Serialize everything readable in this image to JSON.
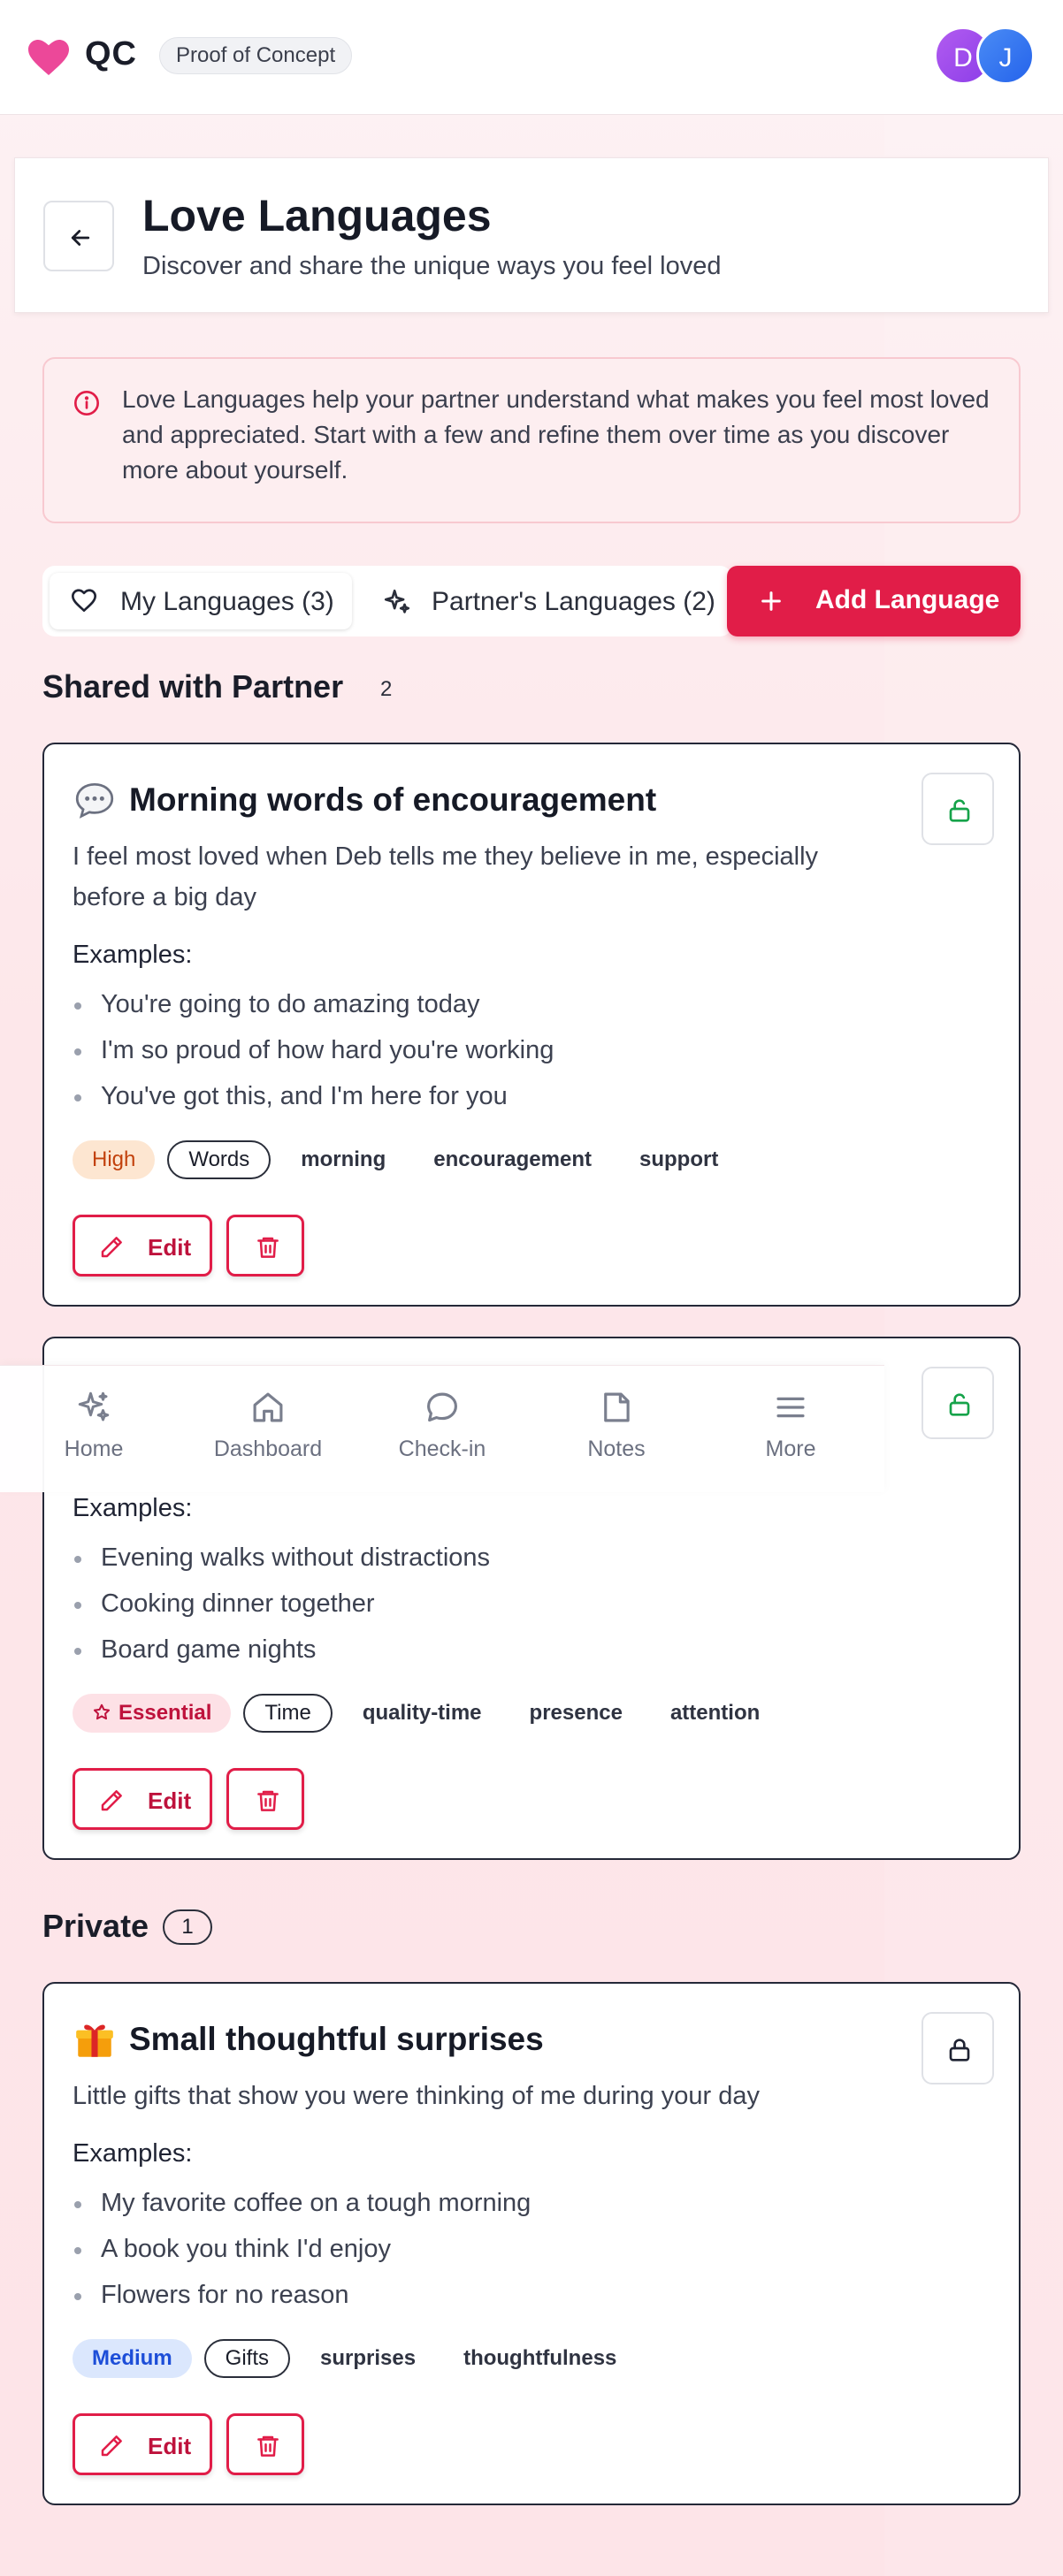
{
  "app": {
    "name": "QC",
    "badge": "Proof of Concept",
    "logo_icon": "heart-icon",
    "brand_color": "#e11d48",
    "avatars": [
      {
        "initial": "D",
        "color": "#a34bee"
      },
      {
        "initial": "J",
        "color": "#3577f0"
      }
    ]
  },
  "header": {
    "title": "Love Languages",
    "subtitle": "Discover and share the unique ways you feel loved"
  },
  "info": {
    "text": "Love Languages help your partner understand what makes you feel most loved and appreciated. Start with a few and refine them over time as you discover more about yourself."
  },
  "tabs": [
    {
      "label": "My Languages (3)",
      "icon": "heart-icon",
      "active": true
    },
    {
      "label": "Partner's Languages (2)",
      "icon": "sparkles-icon",
      "active": false
    }
  ],
  "add_button": {
    "label": "Add Language"
  },
  "sections": {
    "shared": {
      "title": "Shared with Partner",
      "count": "2"
    },
    "private": {
      "title": "Private",
      "count": "1"
    }
  },
  "examples_label": "Examples:",
  "edit_label": "Edit",
  "cards": [
    {
      "emoji": "speech-bubble",
      "title": "Morning words of encouragement",
      "description": "I feel most loved when Deb tells me they believe in me, especially before a big day",
      "examples": [
        "You're going to do amazing today",
        "I'm so proud of how hard you're working",
        "You've got this, and I'm here for you"
      ],
      "importance": "High",
      "category": "Words",
      "keywords": [
        "morning",
        "encouragement",
        "support"
      ],
      "lock": "unlocked"
    },
    {
      "examples": [
        "Evening walks without distractions",
        "Cooking dinner together",
        "Board game nights"
      ],
      "importance": "Essential",
      "category": "Time",
      "keywords": [
        "quality-time",
        "presence",
        "attention"
      ],
      "lock": "unlocked"
    },
    {
      "emoji": "gift",
      "title": "Small thoughtful surprises",
      "description": "Little gifts that show you were thinking of me during your day",
      "examples": [
        "My favorite coffee on a tough morning",
        "A book you think I'd enjoy",
        "Flowers for no reason"
      ],
      "importance": "Medium",
      "category": "Gifts",
      "keywords": [
        "surprises",
        "thoughtfulness"
      ],
      "lock": "locked"
    }
  ],
  "bottom_nav": [
    {
      "label": "Home",
      "icon": "sparkles-icon"
    },
    {
      "label": "Dashboard",
      "icon": "home-icon"
    },
    {
      "label": "Check-in",
      "icon": "chat-bubble-icon"
    },
    {
      "label": "Notes",
      "icon": "note-icon"
    },
    {
      "label": "More",
      "icon": "menu-icon"
    }
  ]
}
